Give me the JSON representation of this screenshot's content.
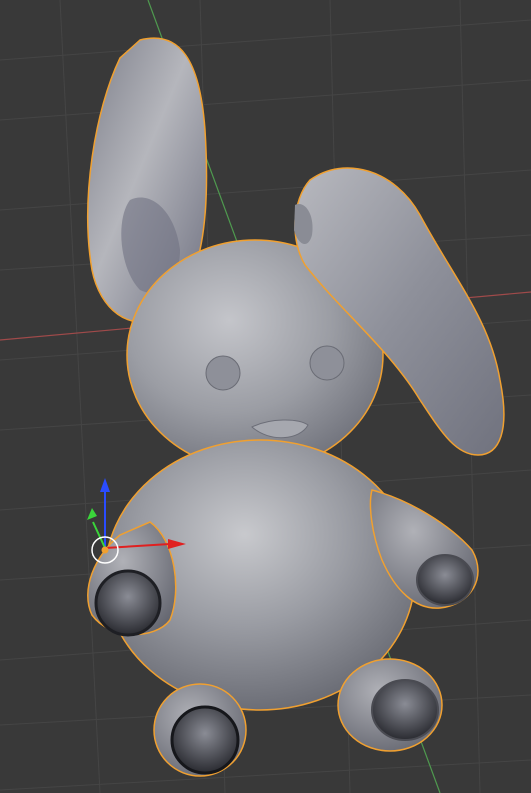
{
  "viewport": {
    "name": "3D Viewport",
    "background": "#393939",
    "grid_color": "#444444",
    "x_axis_color": "#a04a4a",
    "y_axis_color": "#4f9a4f"
  },
  "scene": {
    "object": "bunny-mesh",
    "selected": true,
    "outline_color": "#f0a030",
    "material": "#8c8f99"
  },
  "gizmo": {
    "x_color": "#e02020",
    "y_color": "#3ad43a",
    "z_color": "#2a4cff",
    "origin_color": "#f0a030",
    "cursor_color": "#ffffff"
  }
}
